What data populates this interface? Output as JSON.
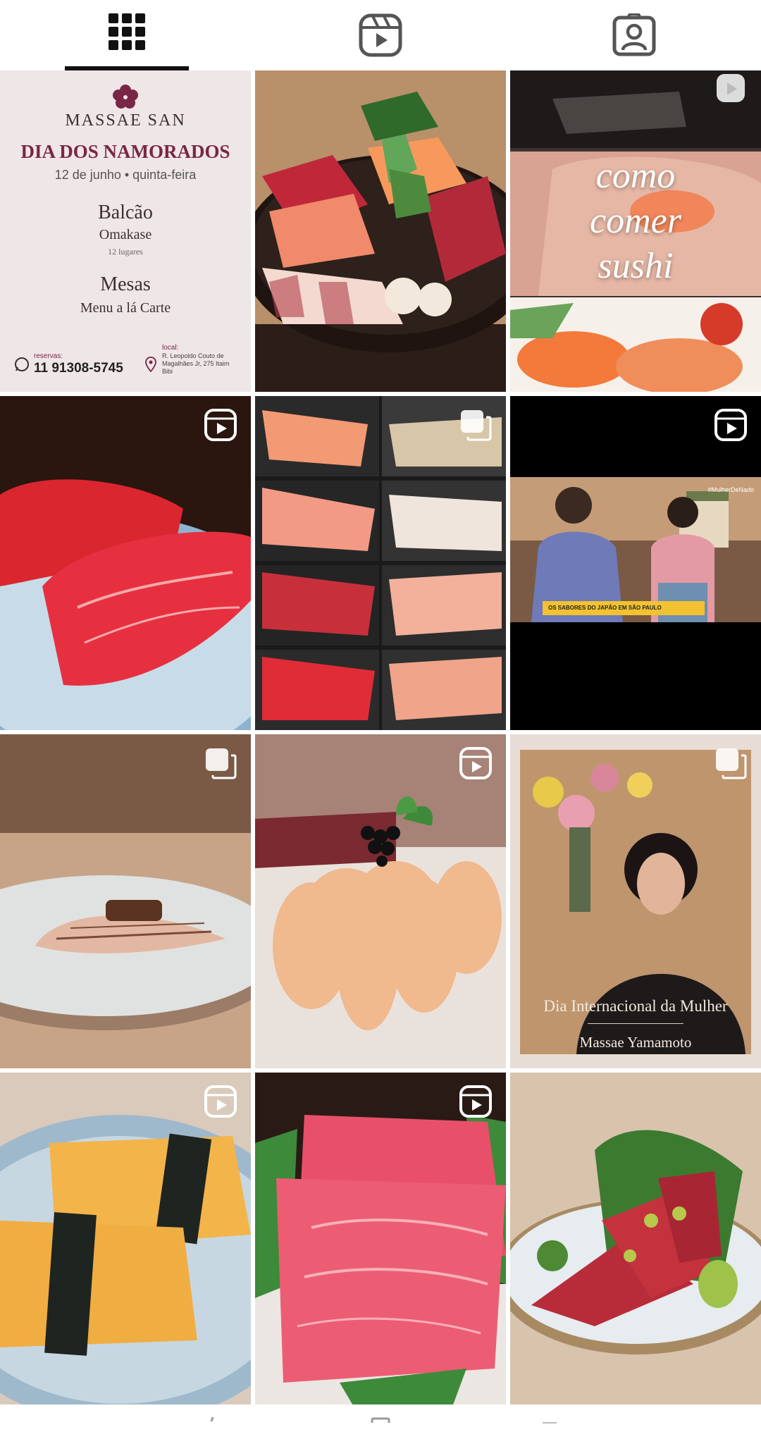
{
  "tabs": [
    {
      "name": "grid",
      "icon": "grid-icon",
      "active": true
    },
    {
      "name": "reels",
      "icon": "reels-icon",
      "active": false
    },
    {
      "name": "tagged",
      "icon": "tagged-person-icon",
      "active": false
    }
  ],
  "posts": [
    {
      "kind": "poster",
      "badge": null,
      "poster": {
        "brand": "MASSAE SAN",
        "event": "DIA DOS NAMORADOS",
        "date": "12 de junho • quinta-feira",
        "section1_title": "Balcão",
        "section1_subtitle": "Omakase",
        "section1_note": "12 lugares",
        "section2_title": "Mesas",
        "section2_subtitle": "Menu a lá Carte",
        "reservations_label": "reservas:",
        "phone": "11 91308-5745",
        "location_label": "local:",
        "address": "R. Leopoldo Couto de Magalhães Jr, 275 Itaim Bibi"
      }
    },
    {
      "kind": "photo",
      "badge": null,
      "subject": "sashimi platter"
    },
    {
      "kind": "photo",
      "badge": "reel",
      "overlay_lines": [
        "como",
        "comer",
        "sushi"
      ]
    },
    {
      "kind": "photo",
      "badge": "reel",
      "subject": "tuna nigiri"
    },
    {
      "kind": "photo",
      "badge": "carousel",
      "subject": "nigiri collage"
    },
    {
      "kind": "video",
      "badge": "reel",
      "tv_caption": "OS SABORES DO JAPÃO EM SÃO PAULO",
      "tv_tag": "#MulherDeNado"
    },
    {
      "kind": "photo",
      "badge": "carousel",
      "subject": "seared fish nigiri"
    },
    {
      "kind": "photo",
      "badge": "reel",
      "subject": "scallop with caviar"
    },
    {
      "kind": "photo",
      "badge": "carousel",
      "memorial_title": "Dia Internacional da Mulher",
      "memorial_name": "Massae Yamamoto"
    },
    {
      "kind": "photo",
      "badge": "reel",
      "subject": "tamago nigiri"
    },
    {
      "kind": "photo",
      "badge": "reel",
      "subject": "toro sashimi"
    },
    {
      "kind": "photo",
      "badge": null,
      "subject": "sashimi plate"
    }
  ]
}
